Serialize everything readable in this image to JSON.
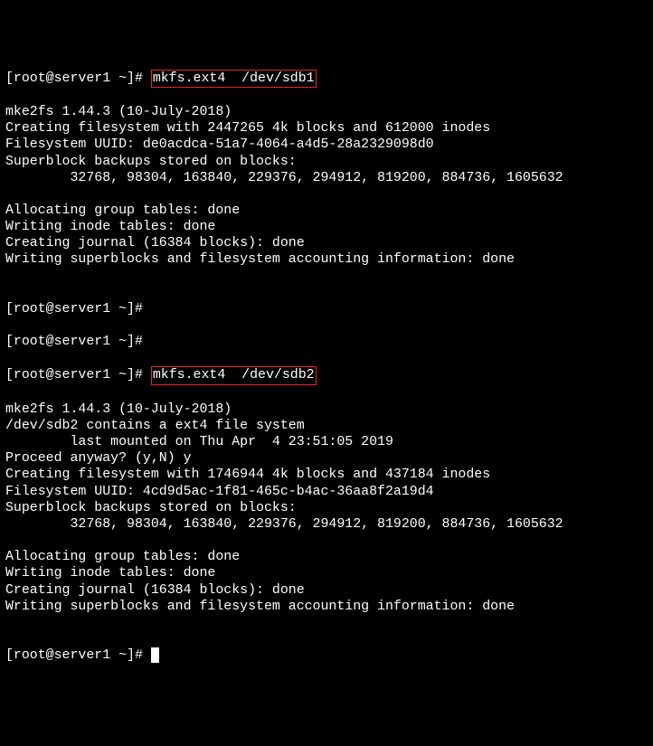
{
  "block1": {
    "prompt": "[root@server1 ~]# ",
    "cmd": "mkfs.ext4  /dev/sdb1",
    "lines": [
      "mke2fs 1.44.3 (10-July-2018)",
      "Creating filesystem with 2447265 4k blocks and 612000 inodes",
      "Filesystem UUID: de0acdca-51a7-4064-a4d5-28a2329098d0",
      "Superblock backups stored on blocks:",
      "        32768, 98304, 163840, 229376, 294912, 819200, 884736, 1605632",
      "",
      "Allocating group tables: done",
      "Writing inode tables: done",
      "Creating journal (16384 blocks): done",
      "Writing superblocks and filesystem accounting information: done",
      ""
    ]
  },
  "emptyPrompt1": "[root@server1 ~]#",
  "emptyPrompt2": "[root@server1 ~]#",
  "block2": {
    "prompt": "[root@server1 ~]# ",
    "cmd": "mkfs.ext4  /dev/sdb2",
    "lines": [
      "mke2fs 1.44.3 (10-July-2018)",
      "/dev/sdb2 contains a ext4 file system",
      "        last mounted on Thu Apr  4 23:51:05 2019",
      "Proceed anyway? (y,N) y",
      "Creating filesystem with 1746944 4k blocks and 437184 inodes",
      "Filesystem UUID: 4cd9d5ac-1f81-465c-b4ac-36aa8f2a19d4",
      "Superblock backups stored on blocks:",
      "        32768, 98304, 163840, 229376, 294912, 819200, 884736, 1605632",
      "",
      "Allocating group tables: done",
      "Writing inode tables: done",
      "Creating journal (16384 blocks): done",
      "Writing superblocks and filesystem accounting information: done",
      ""
    ]
  },
  "finalPrompt": "[root@server1 ~]# "
}
